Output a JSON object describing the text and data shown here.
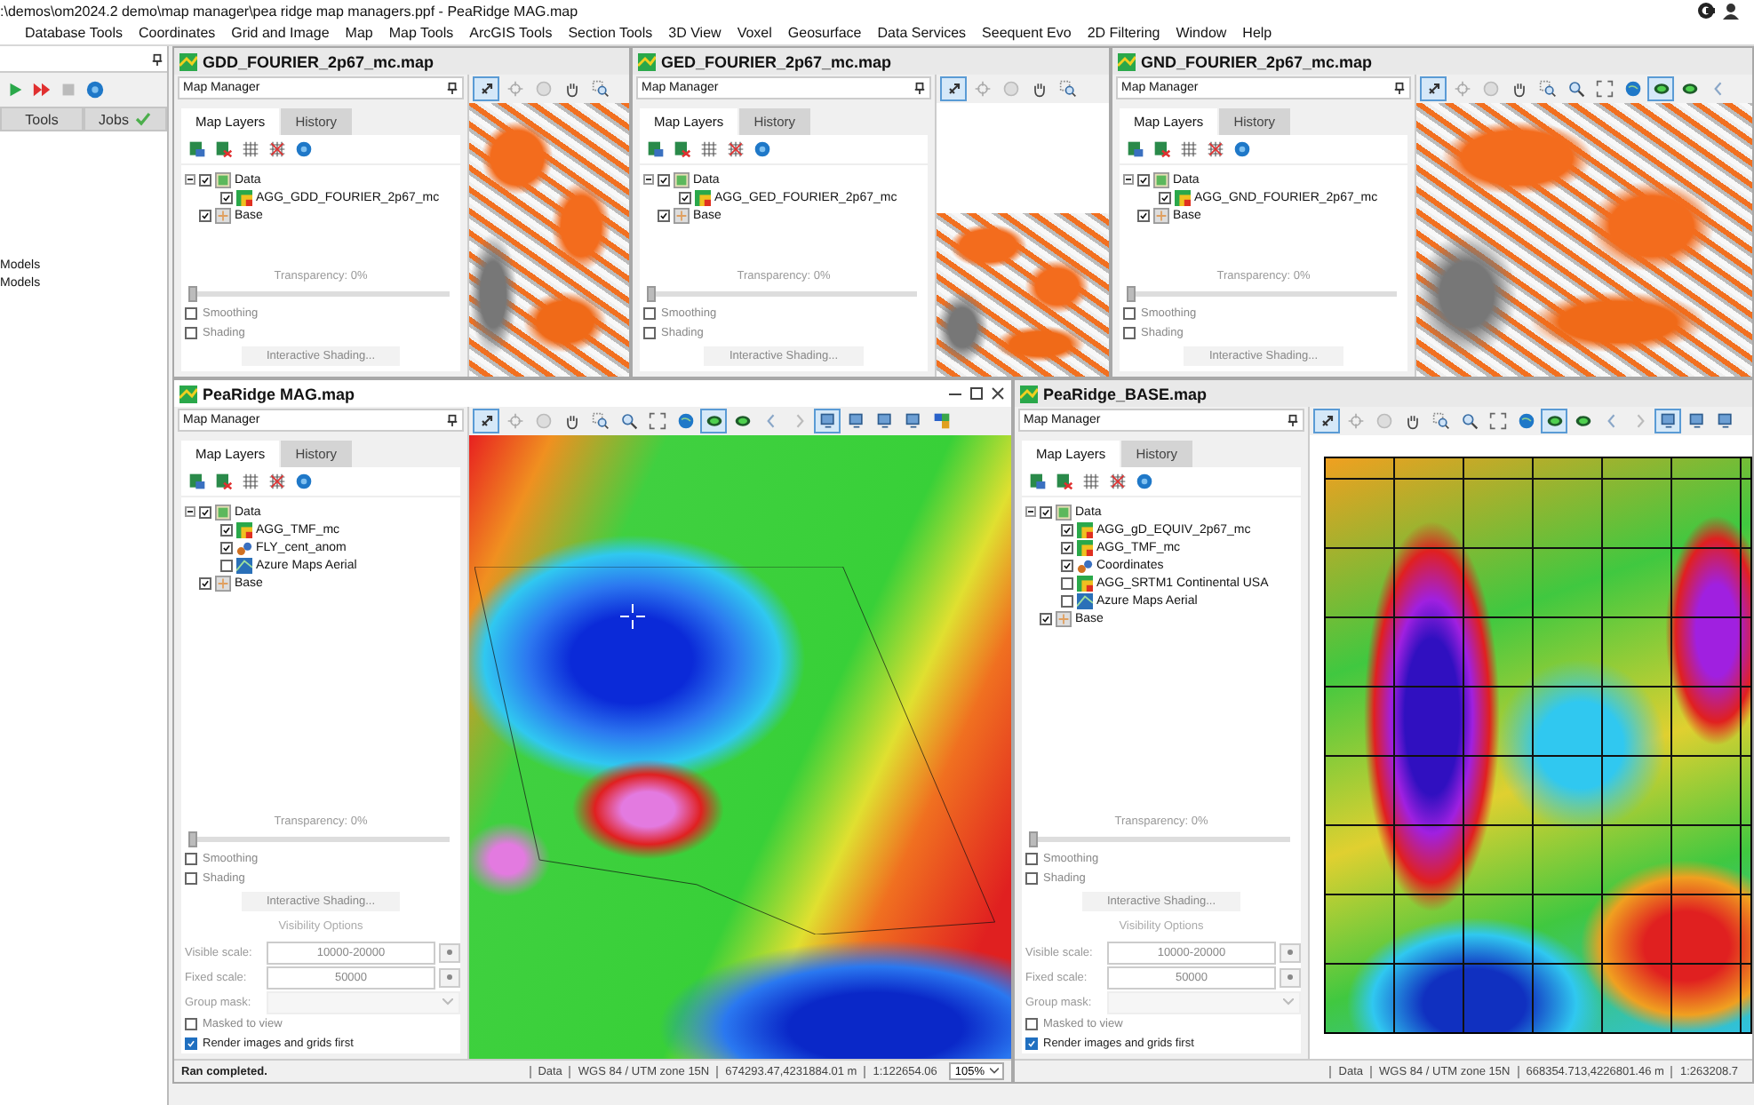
{
  "title_bar": {
    "text": ":\\demos\\om2024.2 demo\\map manager\\pea ridge map managers.ppf - PeaRidge MAG.map"
  },
  "menu": [
    "Database Tools",
    "Coordinates",
    "Grid and Image",
    "Map",
    "Map Tools",
    "ArcGIS Tools",
    "Section Tools",
    "3D View",
    "Voxel",
    "Geosurface",
    "Data Services",
    "Seequent Evo",
    "2D Filtering",
    "Window",
    "Help"
  ],
  "sidebar": {
    "tabs": [
      {
        "label": "Tools",
        "done": false
      },
      {
        "label": "Jobs",
        "done": true
      }
    ],
    "items": [
      "Models",
      "Models"
    ]
  },
  "windows": [
    {
      "title": "GDD_FOURIER_2p67_mc.map",
      "controls": false,
      "map_manager": {
        "title": "Map Manager",
        "tabs": [
          {
            "label": "Map Layers",
            "selected": true
          },
          {
            "label": "History",
            "selected": false
          }
        ],
        "layers": [
          {
            "label": "Data",
            "kind": "group",
            "checked": true,
            "expanded": true,
            "children": [
              {
                "label": "AGG_GDD_FOURIER_2p67_mc",
                "kind": "grid",
                "checked": true
              }
            ]
          },
          {
            "label": "Base",
            "kind": "base",
            "checked": true
          }
        ],
        "transparency": {
          "label": "Transparency: 0%",
          "level": 0
        },
        "options": [
          {
            "label": "Smoothing",
            "checked": false
          },
          {
            "label": "Shading",
            "checked": false
          }
        ],
        "shading_button": "Interactive Shading..."
      },
      "map": {
        "kind": "orange",
        "tools": [
          {
            "kind": "pointer",
            "selected": true
          },
          {
            "kind": "crosshair",
            "selected": false
          },
          {
            "kind": "info",
            "selected": false
          },
          {
            "kind": "hand",
            "selected": false
          },
          {
            "kind": "zoom-box",
            "selected": false
          }
        ]
      }
    },
    {
      "title": "GED_FOURIER_2p67_mc.map",
      "controls": false,
      "map_manager": {
        "title": "Map Manager",
        "tabs": [
          {
            "label": "Map Layers",
            "selected": true
          },
          {
            "label": "History",
            "selected": false
          }
        ],
        "layers": [
          {
            "label": "Data",
            "kind": "group",
            "checked": true,
            "expanded": true,
            "children": [
              {
                "label": "AGG_GED_FOURIER_2p67_mc",
                "kind": "grid",
                "checked": true
              }
            ]
          },
          {
            "label": "Base",
            "kind": "base",
            "checked": true
          }
        ],
        "transparency": {
          "label": "Transparency: 0%",
          "level": 0
        },
        "options": [
          {
            "label": "Smoothing",
            "checked": false
          },
          {
            "label": "Shading",
            "checked": false
          }
        ],
        "shading_button": "Interactive Shading..."
      },
      "map": {
        "kind": "orange-partial",
        "tools": [
          {
            "kind": "pointer",
            "selected": true
          },
          {
            "kind": "crosshair",
            "selected": false
          },
          {
            "kind": "info",
            "selected": false
          },
          {
            "kind": "hand",
            "selected": false
          },
          {
            "kind": "zoom-box",
            "selected": false
          }
        ]
      }
    },
    {
      "title": "GND_FOURIER_2p67_mc.map",
      "controls": false,
      "map_manager": {
        "title": "Map Manager",
        "tabs": [
          {
            "label": "Map Layers",
            "selected": true
          },
          {
            "label": "History",
            "selected": false
          }
        ],
        "layers": [
          {
            "label": "Data",
            "kind": "group",
            "checked": true,
            "expanded": true,
            "children": [
              {
                "label": "AGG_GND_FOURIER_2p67_mc",
                "kind": "grid",
                "checked": true
              }
            ]
          },
          {
            "label": "Base",
            "kind": "base",
            "checked": true
          }
        ],
        "transparency": {
          "label": "Transparency: 0%",
          "level": 0
        },
        "options": [
          {
            "label": "Smoothing",
            "checked": false
          },
          {
            "label": "Shading",
            "checked": false
          }
        ],
        "shading_button": "Interactive Shading..."
      },
      "map": {
        "kind": "orange",
        "tools": [
          {
            "kind": "pointer",
            "selected": true
          },
          {
            "kind": "crosshair",
            "selected": false
          },
          {
            "kind": "info",
            "selected": false
          },
          {
            "kind": "hand",
            "selected": false
          },
          {
            "kind": "zoom-box",
            "selected": false
          },
          {
            "kind": "zoom",
            "selected": false
          },
          {
            "kind": "zoom-extent",
            "selected": false
          },
          {
            "kind": "globe",
            "selected": false
          },
          {
            "kind": "layer",
            "selected": true
          },
          {
            "kind": "layer",
            "selected": false
          },
          {
            "kind": "back",
            "selected": false
          }
        ]
      }
    },
    {
      "title": "PeaRidge MAG.map",
      "controls": true,
      "map_manager": {
        "title": "Map Manager",
        "tabs": [
          {
            "label": "Map Layers",
            "selected": true
          },
          {
            "label": "History",
            "selected": false
          }
        ],
        "layers": [
          {
            "label": "Data",
            "kind": "group",
            "checked": true,
            "expanded": true,
            "children": [
              {
                "label": "AGG_TMF_mc",
                "kind": "grid",
                "checked": true
              },
              {
                "label": "FLY_cent_anom",
                "kind": "points",
                "checked": true
              },
              {
                "label": "Azure Maps Aerial",
                "kind": "aerial",
                "checked": false
              }
            ]
          },
          {
            "label": "Base",
            "kind": "base",
            "checked": true
          }
        ],
        "transparency": {
          "label": "Transparency: 0%",
          "level": 0
        },
        "options": [
          {
            "label": "Smoothing",
            "checked": false
          },
          {
            "label": "Shading",
            "checked": false
          }
        ],
        "shading_button": "Interactive Shading...",
        "visibility": {
          "heading": "Visibility Options",
          "fields": [
            {
              "label": "Visible scale:",
              "kind": "text",
              "value": "10000-20000"
            },
            {
              "label": "Fixed scale:",
              "kind": "text",
              "value": "50000"
            },
            {
              "label": "Group mask:",
              "kind": "dropdown"
            }
          ],
          "options": [
            {
              "label": "Masked to view",
              "checked": false
            },
            {
              "label": "Render images and grids first",
              "checked": true
            }
          ]
        }
      },
      "map": {
        "kind": "rainbow-outline",
        "tools": [
          {
            "kind": "pointer",
            "selected": true
          },
          {
            "kind": "crosshair",
            "selected": false
          },
          {
            "kind": "info",
            "selected": false
          },
          {
            "kind": "hand",
            "selected": false
          },
          {
            "kind": "zoom-box",
            "selected": false
          },
          {
            "kind": "zoom",
            "selected": false
          },
          {
            "kind": "zoom-extent",
            "selected": false
          },
          {
            "kind": "globe",
            "selected": false
          },
          {
            "kind": "layer",
            "selected": true
          },
          {
            "kind": "layer",
            "selected": false
          },
          {
            "kind": "back",
            "selected": false
          },
          {
            "kind": "forward",
            "selected": false
          },
          {
            "kind": "view",
            "selected": true
          },
          {
            "kind": "view",
            "selected": false
          },
          {
            "kind": "view",
            "selected": false
          },
          {
            "kind": "view",
            "selected": false
          },
          {
            "kind": "colors",
            "selected": false
          }
        ]
      },
      "status": {
        "message": "Ran completed.",
        "segments": [
          "Data",
          "WGS 84 / UTM zone 15N",
          "674293.47,4231884.01 m",
          "1:122654.06"
        ],
        "zoom": "105%"
      }
    },
    {
      "title": "PeaRidge_BASE.map",
      "controls": false,
      "map_manager": {
        "title": "Map Manager",
        "tabs": [
          {
            "label": "Map Layers",
            "selected": true
          },
          {
            "label": "History",
            "selected": false
          }
        ],
        "layers": [
          {
            "label": "Data",
            "kind": "group",
            "checked": true,
            "expanded": true,
            "children": [
              {
                "label": "AGG_gD_EQUIV_2p67_mc",
                "kind": "grid",
                "checked": true
              },
              {
                "label": "AGG_TMF_mc",
                "kind": "grid",
                "checked": true
              },
              {
                "label": "Coordinates",
                "kind": "points",
                "checked": true
              },
              {
                "label": "AGG_SRTM1 Continental USA",
                "kind": "grid",
                "checked": false
              },
              {
                "label": "Azure Maps Aerial",
                "kind": "aerial",
                "checked": false
              }
            ]
          },
          {
            "label": "Base",
            "kind": "base",
            "checked": true
          }
        ],
        "transparency": {
          "label": "Transparency: 0%",
          "level": 0
        },
        "options": [
          {
            "label": "Smoothing",
            "checked": false
          },
          {
            "label": "Shading",
            "checked": false
          }
        ],
        "shading_button": "Interactive Shading...",
        "visibility": {
          "heading": "Visibility Options",
          "fields": [
            {
              "label": "Visible scale:",
              "kind": "text",
              "value": "10000-20000"
            },
            {
              "label": "Fixed scale:",
              "kind": "text",
              "value": "50000"
            },
            {
              "label": "Group mask:",
              "kind": "dropdown"
            }
          ],
          "options": [
            {
              "label": "Masked to view",
              "checked": false
            },
            {
              "label": "Render images and grids first",
              "checked": true
            }
          ]
        }
      },
      "map": {
        "kind": "rainbow-grid",
        "tools": [
          {
            "kind": "pointer",
            "selected": true
          },
          {
            "kind": "crosshair",
            "selected": false
          },
          {
            "kind": "info",
            "selected": false
          },
          {
            "kind": "hand",
            "selected": false
          },
          {
            "kind": "zoom-box",
            "selected": false
          },
          {
            "kind": "zoom",
            "selected": false
          },
          {
            "kind": "zoom-extent",
            "selected": false
          },
          {
            "kind": "globe",
            "selected": false
          },
          {
            "kind": "layer",
            "selected": true
          },
          {
            "kind": "layer",
            "selected": false
          },
          {
            "kind": "back",
            "selected": false
          },
          {
            "kind": "forward",
            "selected": false
          },
          {
            "kind": "view",
            "selected": true
          },
          {
            "kind": "view",
            "selected": false
          },
          {
            "kind": "view",
            "selected": false
          }
        ]
      },
      "status": {
        "segments": [
          "Data",
          "WGS 84 / UTM zone 15N",
          "668354.713,4226801.46 m",
          "1:263208.7"
        ]
      }
    }
  ]
}
